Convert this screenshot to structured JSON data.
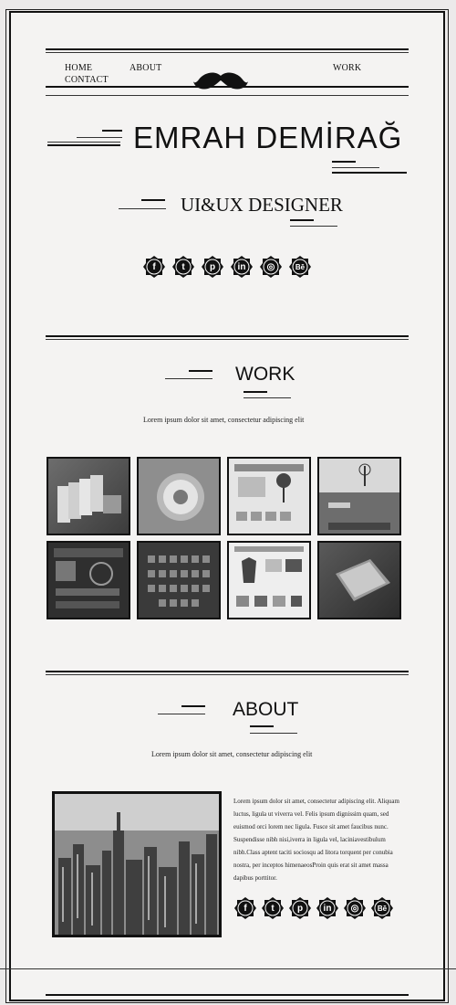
{
  "nav": {
    "home": "HOME",
    "about": "ABOUT",
    "work": "WORK",
    "contact": "CONTACT",
    "logo_icon": "mustache-icon"
  },
  "hero": {
    "name": "EMRAH DEMİRAĞ",
    "role": "UI&UX DESIGNER"
  },
  "social": [
    {
      "icon": "facebook-icon",
      "glyph": "f"
    },
    {
      "icon": "twitter-icon",
      "glyph": "t"
    },
    {
      "icon": "pinterest-icon",
      "glyph": "p"
    },
    {
      "icon": "linkedin-icon",
      "glyph": "in"
    },
    {
      "icon": "dribbble-icon",
      "glyph": "◎"
    },
    {
      "icon": "behance-icon",
      "glyph": "Bē"
    }
  ],
  "work": {
    "title": "WORK",
    "lead": "Lorem ipsum dolor sit amet, consectetur adipiscing elit",
    "items": [
      "app-screens",
      "dial-widget",
      "shop-page",
      "landscape-page",
      "dashboard-ui",
      "icon-grid",
      "clothing-store",
      "tablet-device"
    ]
  },
  "about": {
    "title": "ABOUT",
    "lead": "Lorem ipsum dolor sit amet, consectetur adipiscing elit",
    "body": "Lorem ipsum dolor sit amet, consectetur adipiscing elit. Aliquam luctus, ligula ut viverra vel. Felis ipsum dignissim quam, sed euismod orci lorem nec ligula. Fusce sit amet faucibus nunc. Suspendisse nibh nisi,iverra in ligula vel, laciniavestibulum nibh.Class aptent taciti sociosqu ad litora torquent per conubia nostra, per inceptos himenaeosProin quis erat sit amet massa dapibus porttitor."
  },
  "colors": {
    "ink": "#111111",
    "paper": "#f4f3f2"
  }
}
